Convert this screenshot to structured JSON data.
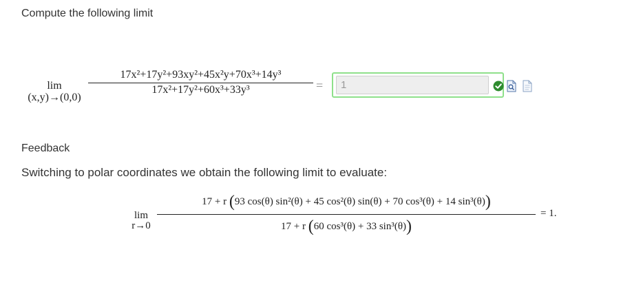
{
  "question": {
    "prompt": "Compute the following limit",
    "limit_label": "lim",
    "limit_sub": "(x,y)→(0,0)",
    "numerator": "17x²+17y²+93xy²+45x²y+70x³+14y³",
    "denominator": "17x²+17y²+60x³+33y³",
    "equals": "="
  },
  "answer": {
    "value": "1",
    "status": "correct",
    "status_color": "#2e9c2e",
    "border_color": "#8ee08a"
  },
  "icons": {
    "status": "check-icon",
    "preview": "preview-icon",
    "document": "doc-icon"
  },
  "feedback": {
    "title": "Feedback",
    "text": "Switching to polar coordinates we obtain the following limit to evaluate:",
    "limit_label": "lim",
    "limit_sub": "r→0",
    "num_prefix": "17 + r",
    "num_inner": "93 cos(θ) sin²(θ) + 45 cos²(θ) sin(θ) + 70 cos³(θ) + 14 sin³(θ)",
    "den_prefix": "17 + r",
    "den_inner": "60 cos³(θ) + 33 sin³(θ)",
    "result": "= 1."
  }
}
